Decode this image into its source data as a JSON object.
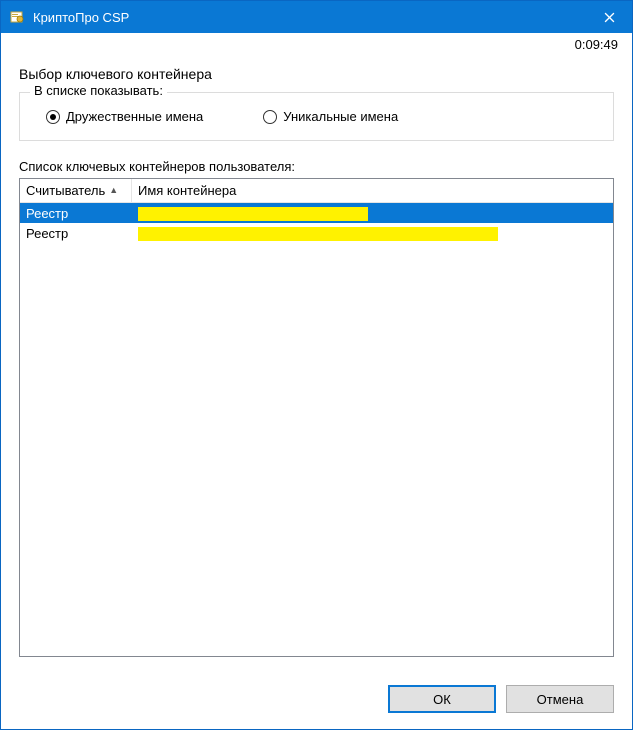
{
  "window": {
    "title": "КриптоПро CSP",
    "timer": "0:09:49"
  },
  "main": {
    "heading": "Выбор ключевого контейнера",
    "group_title": "В списке показывать:",
    "radio_friendly": "Дружественные имена",
    "radio_unique": "Уникальные имена"
  },
  "list": {
    "label": "Список ключевых контейнеров пользователя:",
    "col_reader": "Считыватель",
    "col_name": "Имя контейнера",
    "rows": [
      {
        "reader": "Реестр",
        "name": "",
        "selected": true
      },
      {
        "reader": "Реестр",
        "name": "",
        "selected": false
      }
    ]
  },
  "buttons": {
    "ok": "ОК",
    "cancel": "Отмена"
  }
}
